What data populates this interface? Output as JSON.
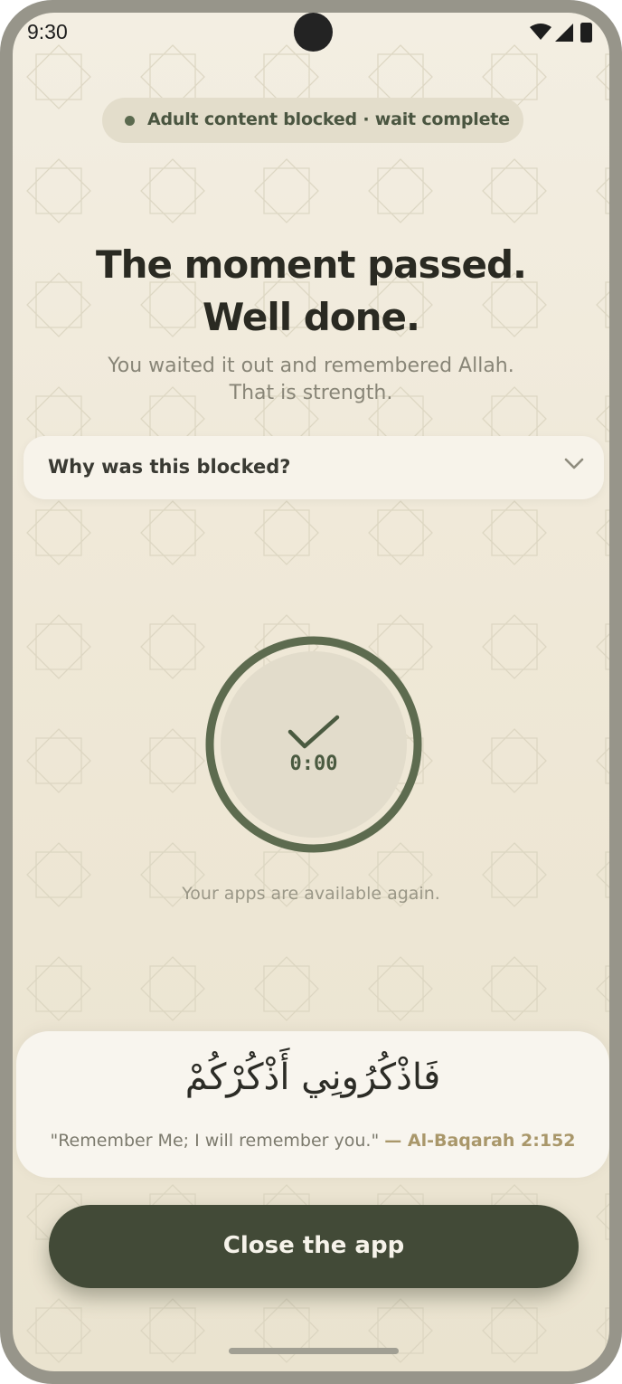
{
  "status_bar": {
    "time": "9:30"
  },
  "banner": {
    "text": "Adult content blocked · wait complete"
  },
  "headline": {
    "line1": "The moment passed.",
    "line2": "Well done."
  },
  "subtitle": {
    "line1": "You waited it out and remembered Allah.",
    "line2": "That is strength."
  },
  "why_blocked": {
    "label": "Why was this blocked?"
  },
  "timer": {
    "display": "0:00",
    "progress": 1.0
  },
  "availability_note": "Your apps are available again.",
  "verse": {
    "arabic": "فَاذْكُرُونِي أَذْكُرْكُمْ",
    "translation": "\"Remember Me; I will remember you.\"",
    "reference": "— Al-Baqarah 2:152"
  },
  "close_button": {
    "label": "Close the app"
  },
  "colors": {
    "accent": "#5b6a4f",
    "button": "#424a37",
    "background": "#f0e9d8",
    "reference": "#a9976a"
  }
}
